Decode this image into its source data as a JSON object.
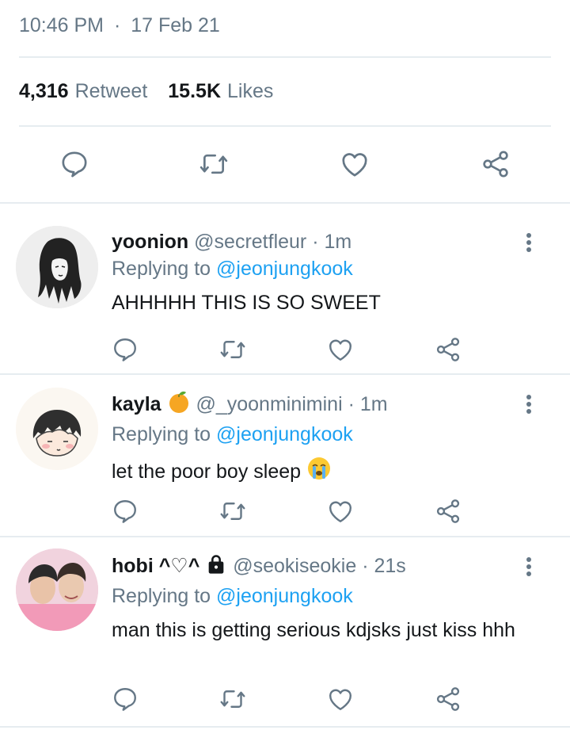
{
  "tweet": {
    "time": "10:46 PM",
    "separator": "·",
    "date": "17 Feb 21",
    "retweet_count": "4,316",
    "retweet_label": "Retweet",
    "like_count": "15.5K",
    "like_label": "Likes"
  },
  "icons": {
    "reply": "reply-icon",
    "retweet": "retweet-icon",
    "like": "heart-icon",
    "share": "share-icon",
    "more": "more-vertical-icon"
  },
  "colors": {
    "text": "#14171a",
    "muted": "#657786",
    "accent": "#1da1f2",
    "divider": "#e6ecf0"
  },
  "replies": [
    {
      "name": "yoonion",
      "handle": "@secretfleur",
      "time": "1m",
      "replying_label": "Replying to",
      "mention": "@jeonjungkook",
      "text": "AHHHHH THIS IS SO SWEET"
    },
    {
      "name": "kayla",
      "name_emoji": "tangerine-emoji",
      "handle": "@_yoonminimini",
      "time": "1m",
      "replying_label": "Replying to",
      "mention": "@jeonjungkook",
      "text": "let the poor boy sleep",
      "text_emoji": "crying-face-emoji"
    },
    {
      "name": "hobi ^♡^",
      "name_emoji": "lock-icon",
      "handle": "@seokiseokie",
      "time": "21s",
      "replying_label": "Replying to",
      "mention": "@jeonjungkook",
      "text": "man this is getting serious kdjsks just kiss hhh"
    }
  ]
}
